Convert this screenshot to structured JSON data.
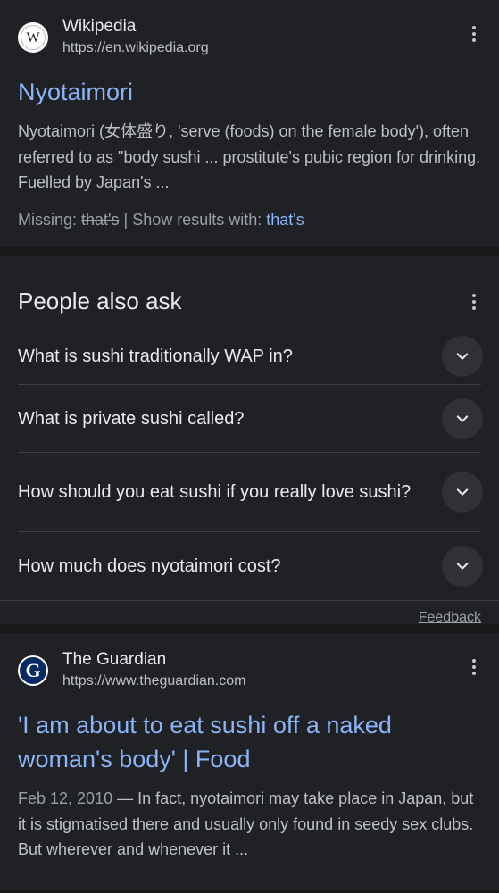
{
  "result1": {
    "source_name": "Wikipedia",
    "source_url": "https://en.wikipedia.org",
    "favicon_letter": "W",
    "title": "Nyotaimori",
    "snippet": "Nyotaimori (女体盛り, 'serve (foods) on the female body'), often referred to as \"body sushi ... prostitute's pubic region for drinking. Fuelled by Japan's ...",
    "missing_label": "Missing:",
    "missing_term": "that's",
    "show_results_label": "| Show results with:",
    "show_results_term": "that's"
  },
  "people_also_ask": {
    "heading": "People also ask",
    "questions": [
      "What is sushi traditionally WAP in?",
      "What is private sushi called?",
      "How should you eat sushi if you really love sushi?",
      "How much does nyotaimori cost?"
    ],
    "feedback_label": "Feedback"
  },
  "result2": {
    "source_name": "The Guardian",
    "source_url": "https://www.theguardian.com",
    "favicon_letter": "G",
    "title": "'I am about to eat sushi off a naked woman's body' | Food",
    "date": "Feb 12, 2010",
    "snippet": " — In fact, nyotaimori may take place in Japan, but it is stigmatised there and usually only found in seedy sex clubs. But wherever and whenever it ..."
  },
  "icons": {
    "more": "kebab-menu-icon",
    "expand": "chevron-down-icon"
  },
  "colors": {
    "background": "#171717",
    "card": "#202124",
    "link": "#8ab4f8",
    "text": "#e8eaed",
    "muted": "#bdc1c6"
  }
}
